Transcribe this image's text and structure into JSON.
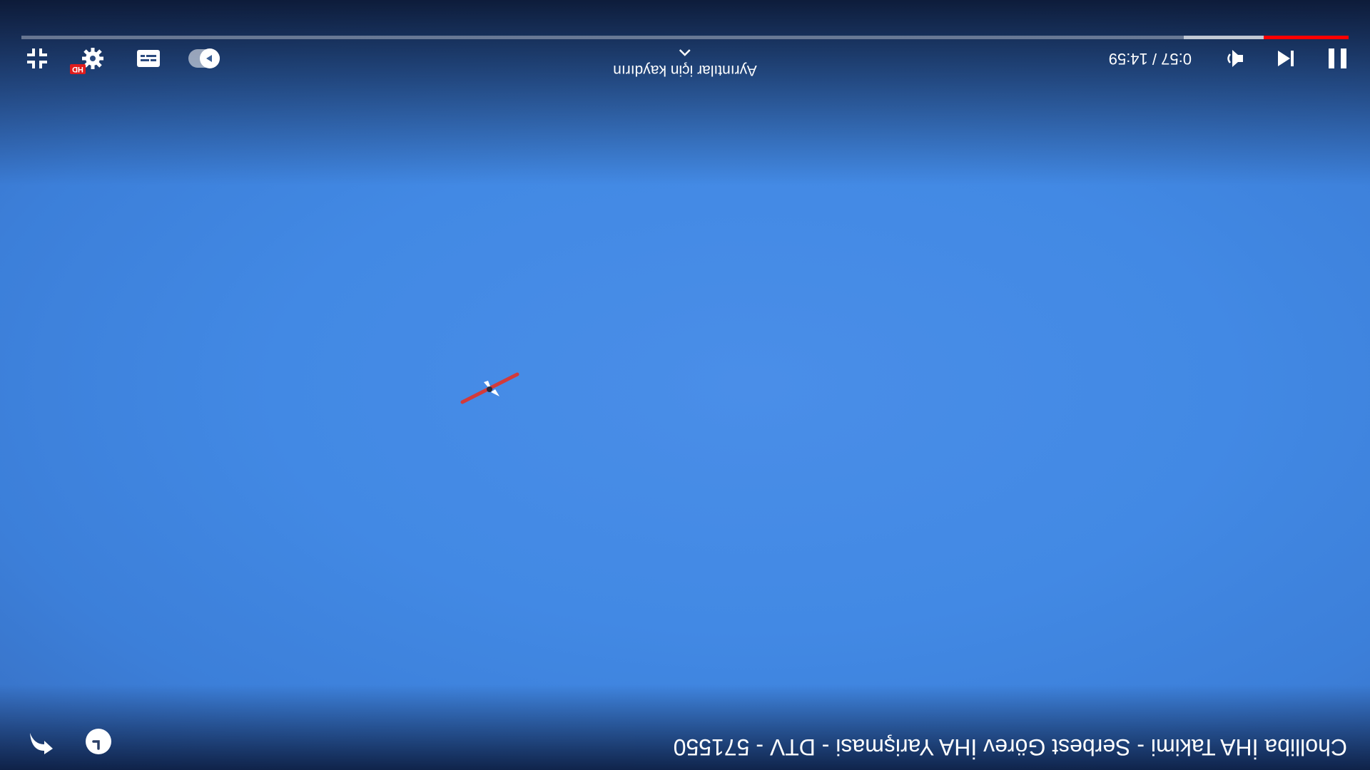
{
  "video": {
    "title": "Cholliba İHA Takimi - Serbest Görev İHA Yarişmasi - DTV - 571550"
  },
  "player": {
    "current_time": "0:57",
    "duration": "14:59",
    "time_separator": "/",
    "progress_fraction": 0.064,
    "buffer_fraction": 0.124,
    "swipe_hint": "Ayrıntılar için kaydırın",
    "quality_badge": "HD"
  },
  "colors": {
    "accent": "#ff0000",
    "sky": "#4289e4"
  },
  "icons": {
    "back": "back-arrow-icon",
    "watch_later": "clock-icon",
    "pause": "pause-icon",
    "previous": "skip-previous-icon",
    "volume": "volume-icon",
    "autoplay": "autoplay-toggle",
    "captions": "captions-icon",
    "settings": "gear-icon",
    "exit_fullscreen": "exit-fullscreen-icon"
  }
}
